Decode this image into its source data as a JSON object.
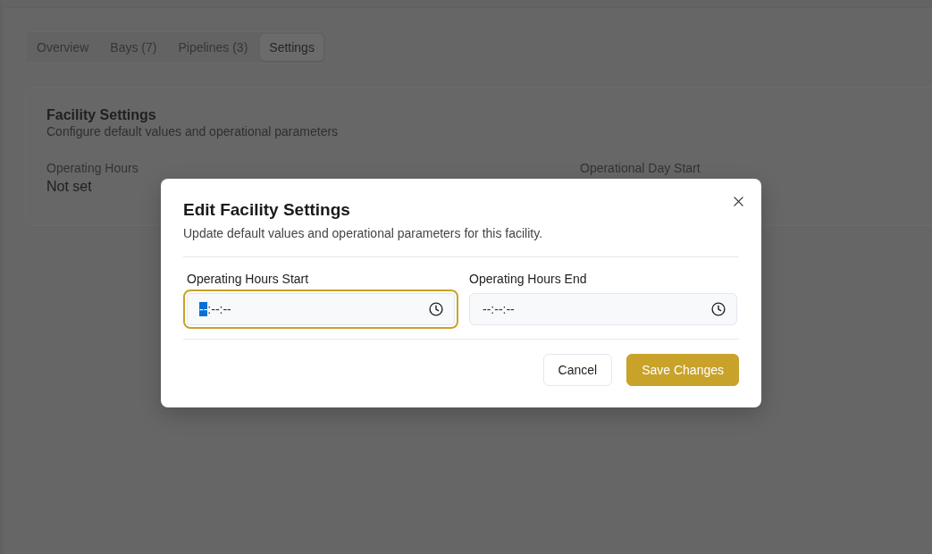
{
  "tabs": [
    {
      "label": "Overview",
      "selected": false
    },
    {
      "label": "Bays (7)",
      "selected": false
    },
    {
      "label": "Pipelines (3)",
      "selected": false
    },
    {
      "label": "Settings",
      "selected": true
    }
  ],
  "settings_card": {
    "title": "Facility Settings",
    "subtitle": "Configure default values and operational parameters",
    "items": [
      {
        "label": "Operating Hours",
        "value": "Not set"
      },
      {
        "label": "Operational Day Start"
      }
    ]
  },
  "dialog": {
    "title": "Edit Facility Settings",
    "description": "Update default values and operational parameters for this facility.",
    "fields": [
      {
        "label": "Operating Hours Start",
        "focused": true,
        "value_parts": [
          {
            "text": "--",
            "selected": true
          },
          {
            "text": ":--:--",
            "selected": false
          }
        ]
      },
      {
        "label": "Operating Hours End",
        "focused": false,
        "value_parts": [
          {
            "text": "--:--:--",
            "selected": false
          }
        ]
      }
    ],
    "buttons": [
      {
        "label": "Cancel",
        "kind": "secondary"
      },
      {
        "label": "Save Changes",
        "kind": "primary"
      }
    ]
  }
}
